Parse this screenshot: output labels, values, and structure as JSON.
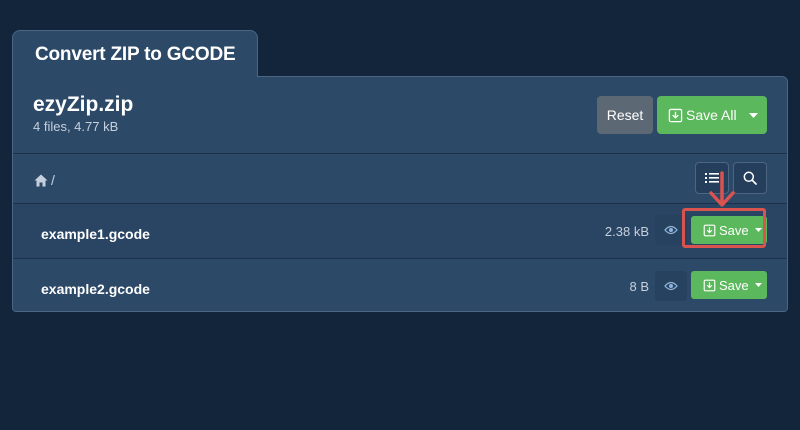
{
  "tab": {
    "title": "Convert ZIP to GCODE"
  },
  "archive": {
    "name": "ezyZip.zip",
    "info": "4 files, 4.77 kB"
  },
  "actions": {
    "reset_label": "Reset",
    "save_all_label": "Save All"
  },
  "breadcrumb": {
    "path": "/"
  },
  "files": [
    {
      "name": "example1.gcode",
      "size": "2.38 kB",
      "save_label": "Save"
    },
    {
      "name": "example2.gcode",
      "size": "8 B",
      "save_label": "Save"
    }
  ],
  "colors": {
    "background": "#12253a",
    "panel": "#2d4968",
    "save_green": "#5cb85c",
    "reset_gray": "#5c6873",
    "highlight_red": "#d9534f"
  },
  "icons": [
    "home-icon",
    "list-icon",
    "search-icon",
    "eye-icon",
    "download-icon",
    "caret-down-icon",
    "arrow-down-icon"
  ]
}
